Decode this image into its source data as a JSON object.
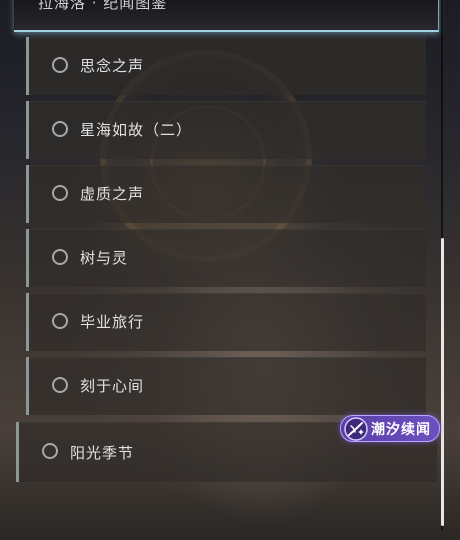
{
  "header": {
    "title": "拉海洛 · 纪闻图鉴"
  },
  "list": {
    "items": [
      {
        "label": "思念之声",
        "selected": false
      },
      {
        "label": "星海如故（二）",
        "selected": false
      },
      {
        "label": "虚质之声",
        "selected": false
      },
      {
        "label": "树与灵",
        "selected": false
      },
      {
        "label": "毕业旅行",
        "selected": false
      },
      {
        "label": "刻于心间",
        "selected": false
      },
      {
        "label": "阳光季节",
        "selected": false
      }
    ]
  },
  "badge": {
    "text": "潮汐续闻",
    "icon": "tidal-sparkle-icon",
    "color": "#6a4cc0"
  },
  "colors": {
    "accent": "#9fd4e0",
    "item_border": "#8a9896",
    "text": "#e2e2e2"
  }
}
